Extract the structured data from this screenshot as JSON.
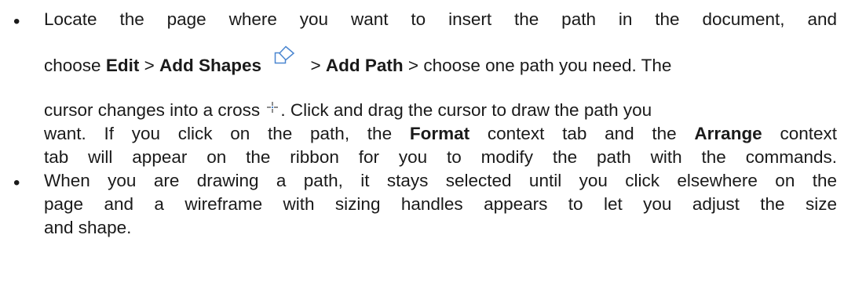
{
  "bullets": [
    {
      "line1": "Locate the page where you want to insert the path in the document, and",
      "line2": {
        "t1": "choose ",
        "edit": "Edit",
        "sep1": " > ",
        "add_shapes": "Add Shapes",
        "sep2": " > ",
        "add_path": "Add Path",
        "t2": " > choose one path you need. The"
      },
      "line3": {
        "t1": "cursor changes into a cross ",
        "t2": ". Click and drag the cursor to draw the path you"
      },
      "line4": {
        "t1": "want. If you click on the path, the ",
        "format": "Format",
        "t2": " context tab and the ",
        "arrange": "Arrange",
        "t3": " context"
      },
      "line5": "tab will appear on the ribbon for you to modify the path with the commands."
    },
    {
      "line1": "When you are drawing a path, it stays selected until you click elsewhere on the",
      "line2": "page and a wireframe with sizing handles appears to let you adjust the size",
      "line3": "and shape."
    }
  ],
  "icons": {
    "shapes_icon": "add-shapes-icon",
    "cross_icon": "cross-cursor-icon",
    "icon_color": "#3a7bd5"
  }
}
